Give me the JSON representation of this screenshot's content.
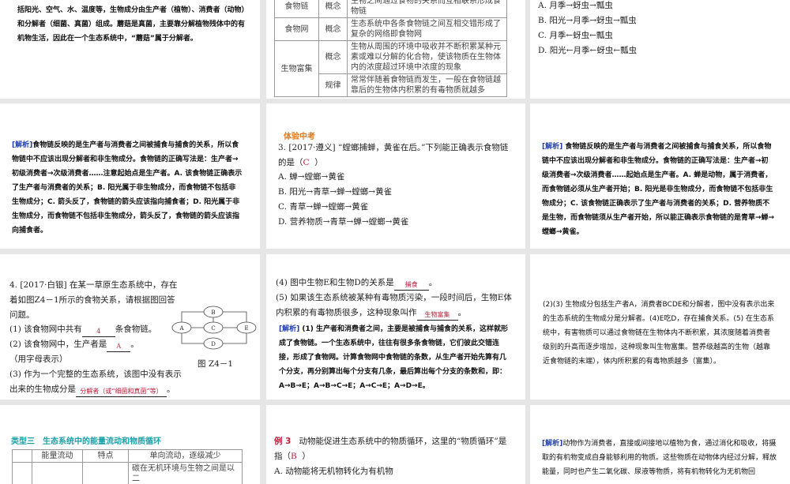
{
  "s1": {
    "text": "括阳光、空气、水、温度等，生物成分由生产者（植物）、消费者（动物）和分解者（细菌、真菌）组成。蘑菇是真菌，主要靠分解植物残体中的有机物生活，因此在一个生态系统中，“蘑菇”属于分解者。"
  },
  "s2": {
    "rows": [
      {
        "name": "食物链",
        "type": "概念",
        "desc": "生物之间通过食物的关系而互相联系形成食物链"
      },
      {
        "name": "食物网",
        "type": "概念",
        "desc": "生态系统中各条食物链之间互相交错形成了复杂的网络即食物网"
      },
      {
        "name": "生物富集",
        "type": "概念",
        "desc": "生物从周围的环境中吸收并不断积累某种元素或难以分解的化合物，使该物质在生物体内的浓度超过环境中浓度的现象"
      },
      {
        "type": "规律",
        "desc": "常常伴随着食物链而发生，一般在食物链越靠后的生物体内积累的有毒物质就越多"
      }
    ]
  },
  "s3": {
    "options": [
      "A. 月季→蚜虫→瓢虫",
      "B. 阳光→月季→蚜虫→瓢虫",
      "C. 月季←蚜虫←瓢虫",
      "D. 阳光←月季←蚜虫←瓢虫"
    ]
  },
  "s4": {
    "label": "[解析]",
    "text": "食物链反映的是生产者与消费者之间被捕食与捕食的关系，所以食物链中不应该出现分解者和非生物成分。食物链的正确写法是：生产者→初级消费者→次级消费者……注意起始点是生产者。A. 该食物链正确表示了生产者与消费者的关系；B. 阳光属于非生物成分，而食物链不包括非生物成分；C. 箭头反了，食物链的箭头应该指向捕食者；D. 阳光属于非生物成分，而食物链不包括非生物成分，箭头反了，食物链的箭头应该指向捕食者。"
  },
  "s5": {
    "section": "体验中考",
    "q1": "3. [2017·遵义] “螳螂捕蝉，黄雀在后。”下列能正确表示食物链的是（",
    "answer": "C",
    "q2": "）",
    "options": [
      "A. 蝉→螳螂→黄雀",
      "B. 阳光→青草→蝉→螳螂→黄雀",
      "C. 青草→蝉→螳螂→黄雀",
      "D. 营养物质→青草→蝉→螳螂→黄雀"
    ]
  },
  "s6": {
    "label": "[解析]",
    "text": "食物链反映的是生产者与消费者之间被捕食与捕食关系，所以食物链中不应该出现分解者和非生物成分。食物链的正确写法是：生产者→初级消费者→次级消费者……起始点是生产者。A. 蝉是动物，属于消费者，而食物链必须从生产者开始；B. 阳光是非生物成分，而食物链不包括非生物成分；C. 该食物链正确表示了生产者与消费者的关系；D. 营养物质不是生物，而食物链须从生产者开始，所以能正确表示食物链的是青草→蝉→螳螂→黄雀。"
  },
  "s7": {
    "q": "4. [2017·白银] 在某一草原生态系统中，存在着如图Z4－1所示的食物关系，请根据图回答问题。",
    "p1a": "(1) 该食物网中共有",
    "a1": "4",
    "p1b": "条食物链。",
    "p2a": "(2) 该食物网中，生产者是",
    "a2": "A",
    "p2b": "。",
    "p2c": "（用字母表示）",
    "p3a": "(3) 作为一个完整的生态系统，该图中没有表示出来的生物成分是",
    "a3": "分解者（或“细菌和真菌”等）",
    "p3b": "。",
    "nodes": [
      "A",
      "B",
      "C",
      "D",
      "E"
    ],
    "caption": "图 Z4－1"
  },
  "s8": {
    "p4a": "(4) 图中生物E和生物D的关系是",
    "a4": "捕食",
    "p4b": "。",
    "p5a": "(5) 如果该生态系统被某种有毒物质污染，一段时间后，生物E体内积累的有毒物质很多，这种现象叫作",
    "a5": "生物富集",
    "p5b": "。",
    "label": "[解析]",
    "text": "(1) 生产者和消费者之间，主要是被捕食与捕食的关系，这样就形成了食物链。一个生态系统中，往往有很多条食物链，它们彼此交错连接，形成了食物网。计算食物网中食物链的条数，从生产者开始先算有几个分支，再分别算出每个分支有几条，最后算出每个分支的条数和，即：A→B→E；A→B→C→E；A→C→E；A→D→E。"
  },
  "s9": {
    "text": "(2)(3) 生物成分包括生产者A，消费者BCDE和分解者，图中没有表示出来的生态系统的生物成分是分解者。(4)E吃D，存在捕食关系。(5) 在生态系统中，有害物质可以通过食物链在生物体内不断积累，其浓度随着消费者级别的升高而逐步增加，这种现象叫生物富集。营养级越高的生物（越靠近食物链的末端），体内所积累的有毒物质越多（富集）。"
  },
  "s10": {
    "title": "类型三　生态系统中的能量流动和物质循环",
    "row1": [
      "能量流动",
      "特点",
      "单向流动，逐级减少"
    ],
    "row2": "碳在无机环境与生物之间是以二"
  },
  "s11": {
    "label": "例 3",
    "q": "动物能促进生态系统中的物质循环，这里的“物质循环”是指（",
    "answer": "B",
    "q2": "）",
    "optA": "A. 动物能将无机物转化为有机物"
  },
  "s12": {
    "label": "[解析]",
    "text": "动物作为消费者，直接或间接地以植物为食，通过消化和吸收，将摄取的有机物变成自身能够利用的物质。这些物质在动物体内经过分解，释放能量，同时也产生二氧化碳、尿液等物质，将有机物转化为无机物回"
  }
}
